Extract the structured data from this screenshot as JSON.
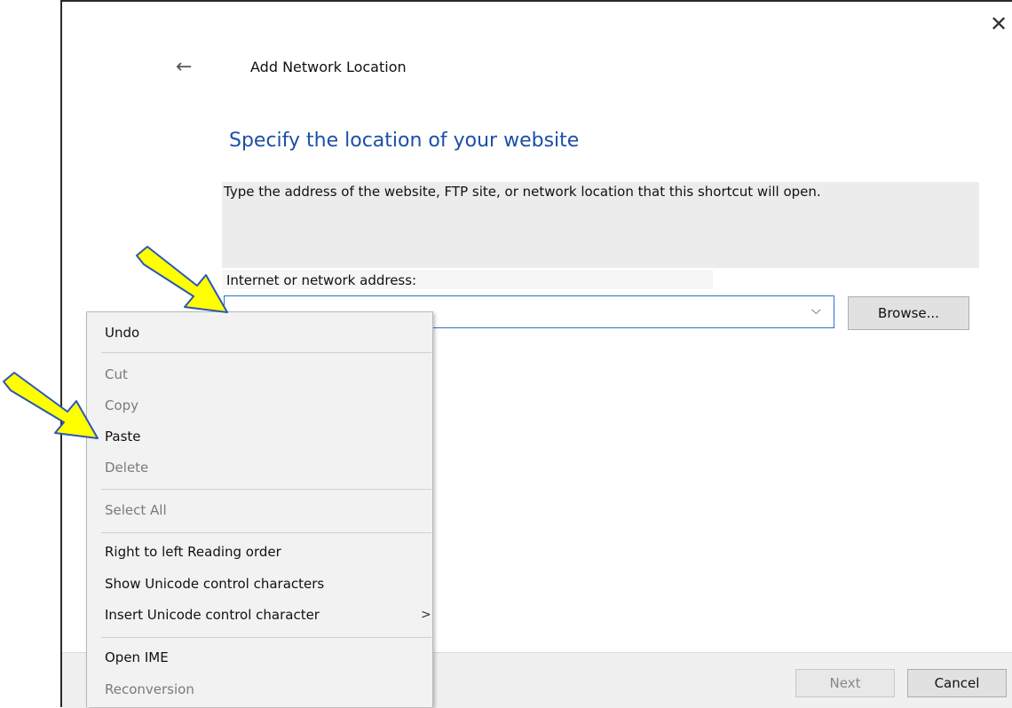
{
  "window": {
    "title": "Add Network Location",
    "close_glyph": "✕",
    "back_glyph": "←"
  },
  "main": {
    "heading": "Specify the location of your website",
    "description": "Type the address of the website, FTP site, or network location that this shortcut will open.",
    "address_label": "Internet or network address:",
    "address_value": "",
    "dropdown_glyph": "⌵",
    "browse_label": "Browse..."
  },
  "footer": {
    "next_label": "Next",
    "cancel_label": "Cancel"
  },
  "context_menu": {
    "items": [
      {
        "label": "Undo",
        "enabled": true
      },
      {
        "label": "Cut",
        "enabled": false
      },
      {
        "label": "Copy",
        "enabled": false
      },
      {
        "label": "Paste",
        "enabled": true
      },
      {
        "label": "Delete",
        "enabled": false
      },
      {
        "label": "Select All",
        "enabled": false
      },
      {
        "label": "Right to left Reading order",
        "enabled": true
      },
      {
        "label": "Show Unicode control characters",
        "enabled": true
      },
      {
        "label": "Insert Unicode control character",
        "enabled": true,
        "submenu": true
      },
      {
        "label": "Open IME",
        "enabled": true
      },
      {
        "label": "Reconversion",
        "enabled": false
      }
    ],
    "submenu_glyph": ">"
  },
  "annotations": {
    "arrow_color": "#ffff00",
    "arrow_outline": "#2b55b8"
  },
  "colors": {
    "heading": "#1c4fa6",
    "input_border": "#2e6fd1"
  }
}
